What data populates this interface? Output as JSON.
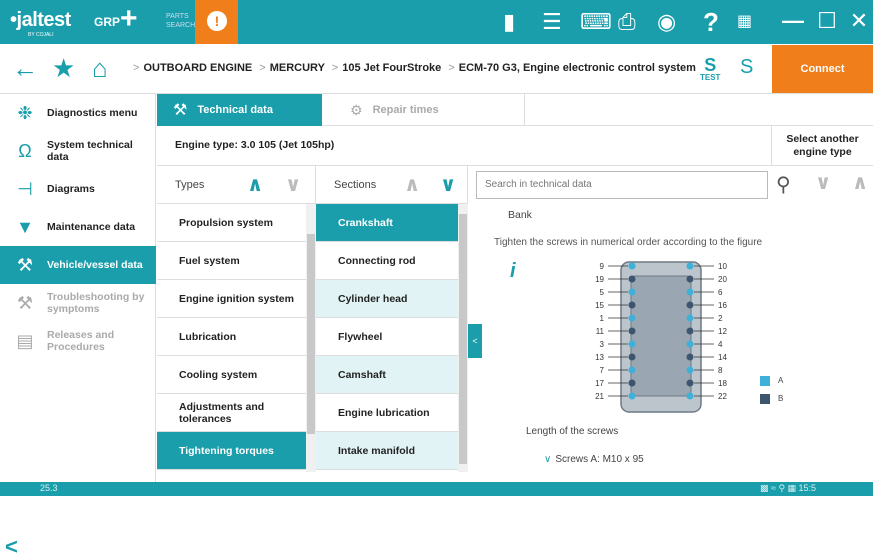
{
  "topbar": {
    "logo": "jaltest",
    "logo_sub": "BY COJALI",
    "grp": "GRP",
    "parts_search": "PARTS SEARCH"
  },
  "breadcrumb": [
    "OUTBOARD ENGINE",
    "MERCURY",
    "105 Jet FourStroke",
    "ECM-70 G3, Engine electronic control system"
  ],
  "test_label": "TEST",
  "connect_label": "Connect",
  "sidebar": {
    "items": [
      {
        "label": "Diagnostics menu",
        "icon": "stethoscope-icon",
        "state": "normal"
      },
      {
        "label": "System technical data",
        "icon": "omega-icon",
        "state": "normal"
      },
      {
        "label": "Diagrams",
        "icon": "diagram-icon",
        "state": "normal"
      },
      {
        "label": "Maintenance data",
        "icon": "oil-can-icon",
        "state": "normal"
      },
      {
        "label": "Vehicle/vessel data",
        "icon": "wrench-icon",
        "state": "active"
      },
      {
        "label": "Troubleshooting by symptoms",
        "icon": "tools-icon",
        "state": "disabled"
      },
      {
        "label": "Releases and Procedures",
        "icon": "document-icon",
        "state": "disabled"
      }
    ]
  },
  "tabs": {
    "technical_data": "Technical data",
    "repair_times": "Repair times"
  },
  "engine_type": "Engine type:  3.0 105 (Jet 105hp)",
  "select_another": "Select another engine type",
  "types": {
    "header": "Types",
    "items": [
      "Propulsion system",
      "Fuel system",
      "Engine ignition system",
      "Lubrication",
      "Cooling system",
      "Adjustments and tolerances",
      "Tightening torques"
    ],
    "selected": 6
  },
  "sections": {
    "header": "Sections",
    "items": [
      "Crankshaft",
      "Connecting rod",
      "Cylinder head",
      "Flywheel",
      "Camshaft",
      "Engine lubrication",
      "Intake manifold"
    ],
    "selected": 0
  },
  "search": {
    "placeholder": "Search in technical data"
  },
  "content": {
    "bank": "Bank",
    "instruction": "Tighten the screws in numerical order according to the figure",
    "figure_left_numbers": [
      "9",
      "19",
      "5",
      "15",
      "1",
      "11",
      "3",
      "13",
      "7",
      "17",
      "21"
    ],
    "figure_right_numbers": [
      "10",
      "20",
      "6",
      "16",
      "2",
      "12",
      "4",
      "14",
      "8",
      "18",
      "22"
    ],
    "legend_a": "A",
    "legend_b": "B",
    "length_title": "Length of the screws",
    "screws_a": "Screws A: M10 x 95"
  },
  "footer": {
    "version": "25.3",
    "time": "15:5"
  },
  "colors": {
    "accent": "#1a9eab",
    "orange": "#f07f1b",
    "legend_a": "#3fb0d8",
    "legend_b": "#3d556e"
  }
}
